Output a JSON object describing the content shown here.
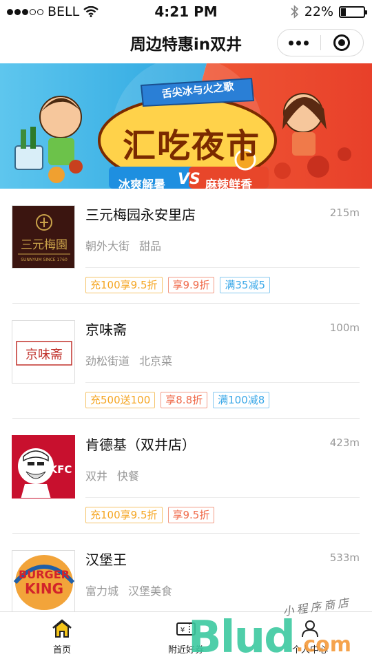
{
  "status_bar": {
    "carrier": "BELL",
    "time": "4:21 PM",
    "battery_text": "22%",
    "battery_level": 0.22
  },
  "nav": {
    "title": "周边特惠in双井"
  },
  "banner": {
    "subtitle": "舌尖冰与火之歌",
    "title": "汇吃夜市",
    "left_text": "冰爽解暑",
    "vs": "VS",
    "right_text": "麻辣鲜香",
    "left_color": "#2ba6e0",
    "right_color": "#e8462a"
  },
  "stores": [
    {
      "name": "三元梅园永安里店",
      "distance": "215m",
      "area": "朝外大街",
      "category": "甜品",
      "logo_text": "三元梅園",
      "logo_sub": "SUNNYUM SINCE 1760",
      "tags": [
        {
          "text": "充100享9.5折",
          "color": "orange"
        },
        {
          "text": "享9.9折",
          "color": "red"
        },
        {
          "text": "满35减5",
          "color": "blue"
        }
      ]
    },
    {
      "name": "京味斋",
      "distance": "100m",
      "area": "劲松街道",
      "category": "北京菜",
      "logo_text": "京味斋",
      "tags": [
        {
          "text": "充500送100",
          "color": "orange"
        },
        {
          "text": "享8.8折",
          "color": "red"
        },
        {
          "text": "满100减8",
          "color": "blue"
        }
      ]
    },
    {
      "name": "肯德基（双井店）",
      "distance": "423m",
      "area": "双井",
      "category": "快餐",
      "logo_text": "KFC",
      "tags": [
        {
          "text": "充100享9.5折",
          "color": "orange"
        },
        {
          "text": "享9.5折",
          "color": "red"
        }
      ]
    },
    {
      "name": "汉堡王",
      "distance": "533m",
      "area": "富力城",
      "category": "汉堡美食",
      "logo_text_top": "BURGER",
      "logo_text_bottom": "KING",
      "tags": []
    }
  ],
  "tabs": [
    {
      "label": "首页",
      "icon": "home-icon"
    },
    {
      "label": "附近好券",
      "icon": "coupon-icon"
    },
    {
      "label": "个人中心",
      "icon": "user-icon"
    }
  ],
  "watermark": {
    "letters": "Blud",
    "com": ".com",
    "script": "小程序商店"
  }
}
